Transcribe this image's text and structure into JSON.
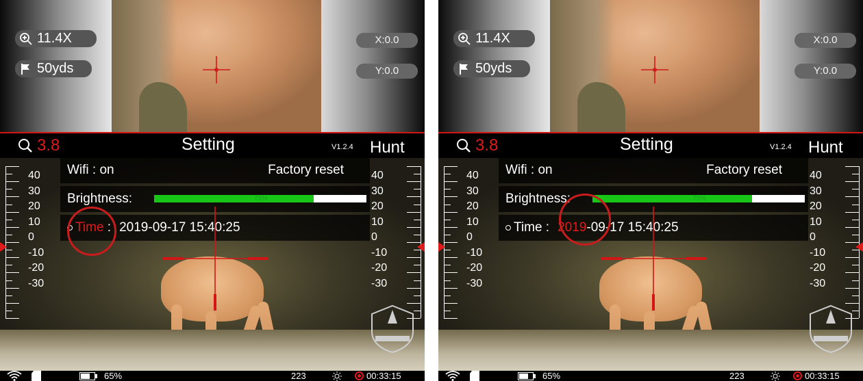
{
  "screens": [
    {
      "zoom": "11.4X",
      "distance": "50yds",
      "x_offset": "X:0.0",
      "y_offset": "Y:0.0",
      "magnification": "3.8",
      "setting_title": "Setting",
      "version": "V1.2.4",
      "mode": "Hunt",
      "wifi_label": "Wifi :  on",
      "factory_reset": "Factory reset",
      "brightness_label": "Brightness:",
      "brightness_pct": "75%",
      "brightness_value": 0.75,
      "time_label": "Time",
      "time_colon": " :",
      "time_year": "2019",
      "time_rest": "-09-17  15:40:25",
      "highlighted": "label",
      "ruler_values": [
        "40",
        "30",
        "20",
        "10",
        "0",
        "-10",
        "-20",
        "-30"
      ],
      "battery": "65%",
      "count": "223",
      "rec_time": "00:33:15"
    },
    {
      "zoom": "11.4X",
      "distance": "50yds",
      "x_offset": "X:0.0",
      "y_offset": "Y:0.0",
      "magnification": "3.8",
      "setting_title": "Setting",
      "version": "V1.2.4",
      "mode": "Hunt",
      "wifi_label": "Wifi :  on",
      "factory_reset": "Factory reset",
      "brightness_label": "Brightness:",
      "brightness_pct": "75%",
      "brightness_value": 0.75,
      "time_label": "Time",
      "time_colon": " :",
      "time_year": "2019",
      "time_rest": "-09-17  15:40:25",
      "highlighted": "year",
      "ruler_values": [
        "40",
        "30",
        "20",
        "10",
        "0",
        "-10",
        "-20",
        "-30"
      ],
      "battery": "65%",
      "count": "223",
      "rec_time": "00:33:15"
    }
  ],
  "colors": {
    "accent": "#e01b1b",
    "brightness_fill": "#17c617",
    "bubble": "#555555"
  },
  "icons": [
    "magnify-plus-icon",
    "flag-icon",
    "search-icon",
    "wifi-icon",
    "sd-card-icon",
    "battery-icon",
    "sun-icon",
    "record-icon"
  ]
}
